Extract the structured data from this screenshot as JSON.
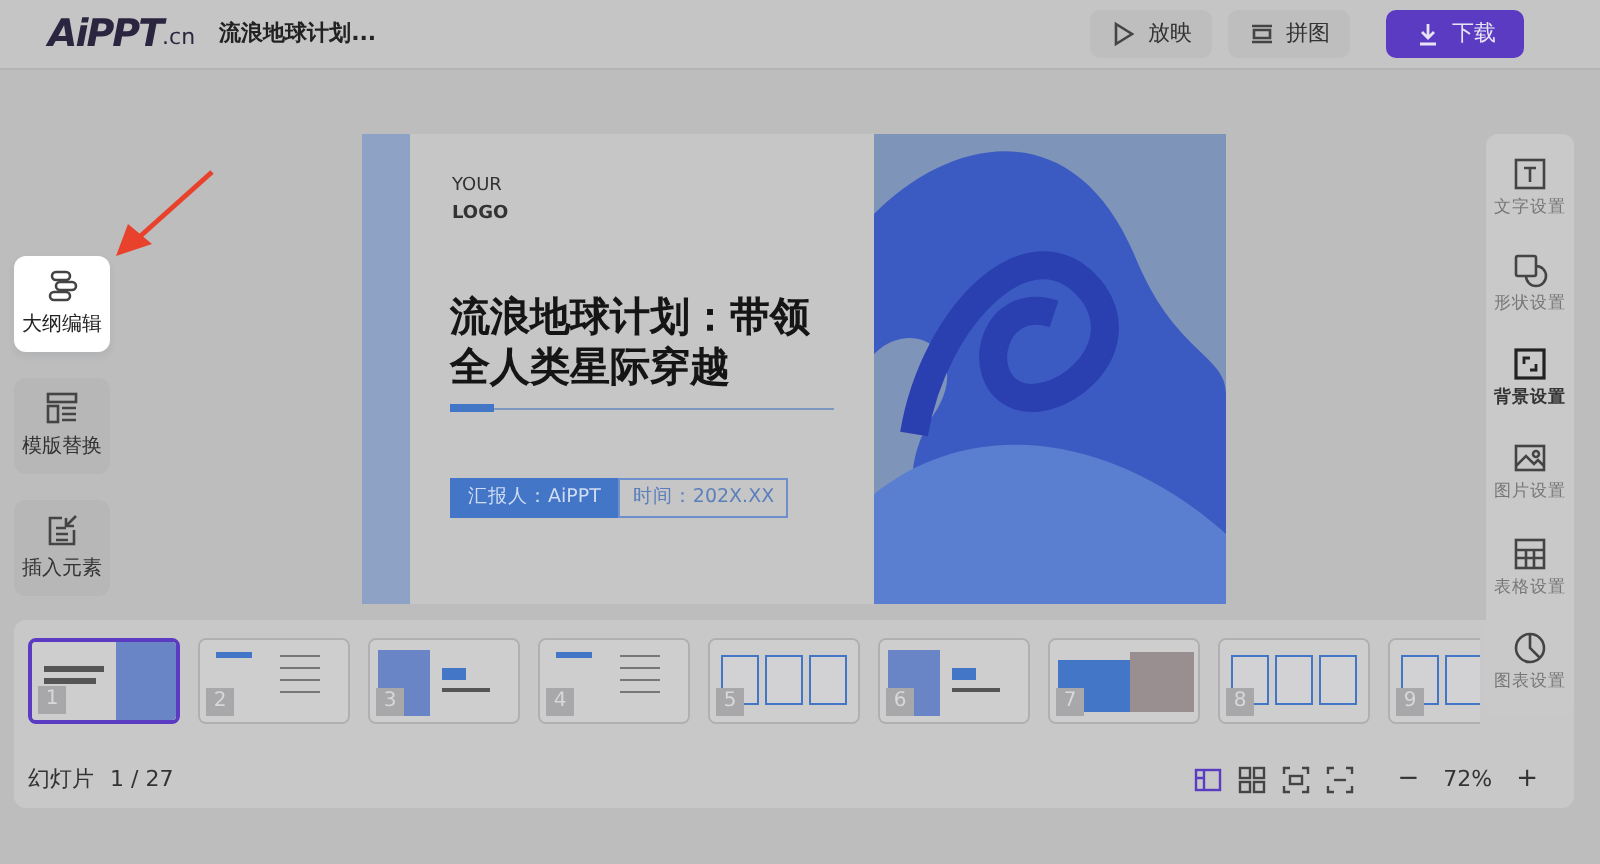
{
  "header": {
    "logo": "AiPPT",
    "logo_suffix": ".cn",
    "title": "流浪地球计划...",
    "buttons": [
      {
        "label": "放映",
        "kind": "play"
      },
      {
        "label": "拼图",
        "kind": "puzzle"
      },
      {
        "label": "下载",
        "kind": "download"
      }
    ]
  },
  "left_tools": [
    {
      "label": "大纲编辑",
      "kind": "outline",
      "highlighted": true
    },
    {
      "label": "模版替换",
      "kind": "template",
      "highlighted": false
    },
    {
      "label": "插入元素",
      "kind": "insert",
      "highlighted": false
    }
  ],
  "slide": {
    "logo_top": "YOUR",
    "logo_bottom": "LOGO",
    "title_lines": [
      "流浪地球计划：带领",
      "全人类星际穿越"
    ],
    "presenter": "汇报人：AiPPT",
    "time": "时间：202X.XX"
  },
  "right_tools": [
    {
      "label": "文字设置",
      "kind": "text",
      "selected": false
    },
    {
      "label": "形状设置",
      "kind": "shape",
      "selected": false
    },
    {
      "label": "背景设置",
      "kind": "background",
      "selected": true
    },
    {
      "label": "图片设置",
      "kind": "image",
      "selected": false
    },
    {
      "label": "表格设置",
      "kind": "table",
      "selected": false
    },
    {
      "label": "图表设置",
      "kind": "chart",
      "selected": false
    }
  ],
  "thumbnails": [
    {
      "number": "1",
      "kind": "cover",
      "selected": true
    },
    {
      "number": "2",
      "kind": "list",
      "selected": false
    },
    {
      "number": "3",
      "kind": "section",
      "selected": false
    },
    {
      "number": "4",
      "kind": "list",
      "selected": false
    },
    {
      "number": "5",
      "kind": "cards",
      "selected": false
    },
    {
      "number": "6",
      "kind": "section",
      "selected": false
    },
    {
      "number": "7",
      "kind": "photo",
      "selected": false
    },
    {
      "number": "8",
      "kind": "cards",
      "selected": false
    },
    {
      "number": "9",
      "kind": "cards",
      "selected": false
    }
  ],
  "status": {
    "slide_label": "幻灯片",
    "slide_count": "1 / 27",
    "views": [
      {
        "kind": "normal",
        "selected": true
      },
      {
        "kind": "grid",
        "selected": false
      },
      {
        "kind": "fit",
        "selected": false
      },
      {
        "kind": "fullscreen",
        "selected": false
      }
    ],
    "zoom_out": "−",
    "zoom": "72%",
    "zoom_in": "+"
  }
}
